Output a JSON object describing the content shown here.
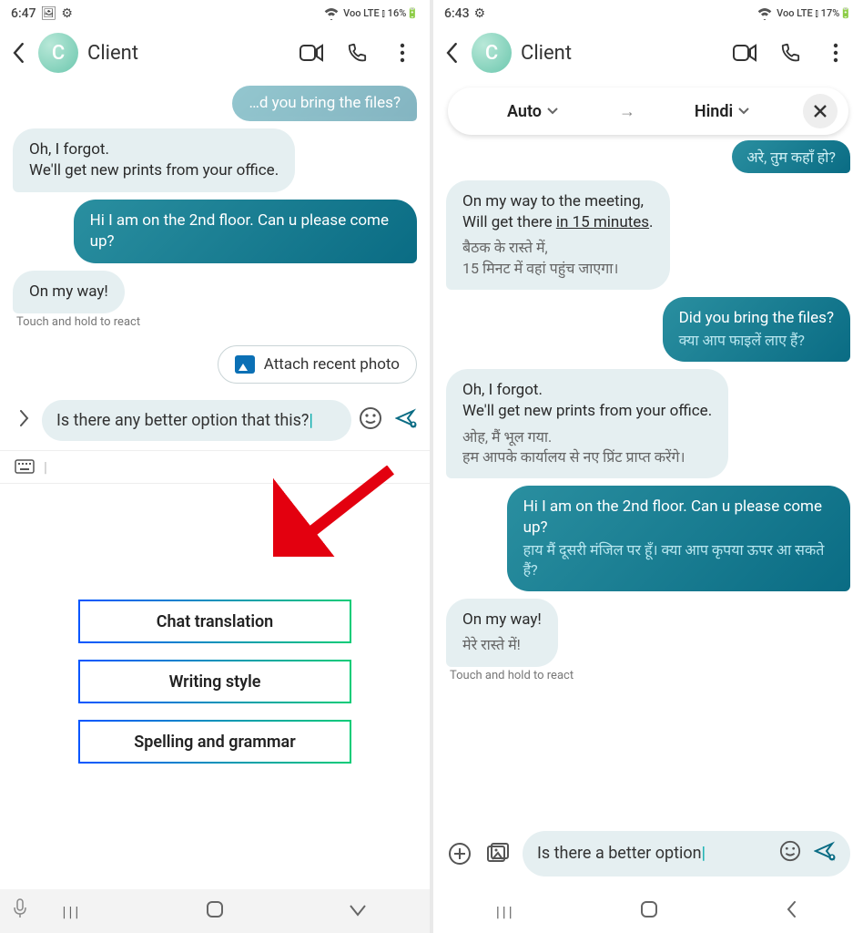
{
  "left": {
    "status": {
      "time": "6:47",
      "indicators": "Voo LTE ⫾ 16%🔋"
    },
    "contact": {
      "initial": "C",
      "name": "Client"
    },
    "messages": {
      "m0": "…d you bring the files?",
      "m1": "Oh, I forgot.\nWe'll get new prints from your office.",
      "m2": "Hi I am on the 2nd floor. Can u please come up?",
      "m3": "On my way!",
      "hint": "Touch and hold to react"
    },
    "attach": "Attach recent photo",
    "compose": "Is there any better option that this?",
    "options": {
      "o1": "Chat translation",
      "o2": "Writing style",
      "o3": "Spelling and grammar"
    }
  },
  "right": {
    "status": {
      "time": "6:43",
      "indicators": "Voo LTE ⫾ 17%🔋"
    },
    "contact": {
      "initial": "C",
      "name": "Client"
    },
    "translate": {
      "from": "Auto",
      "to": "Hindi"
    },
    "messages": {
      "m0": {
        "text": "अरे, तुम कहाँ हो?"
      },
      "m1": {
        "text": "On my way to the meeting,\nWill get there ",
        "link": "in 15 minutes",
        "tail": ".",
        "trans": "बैठक के रास्ते में,\n15 मिनट में वहां पहुंच जाएगा।"
      },
      "m2": {
        "text": "Did you bring the files?",
        "trans": "क्या आप फाइलें लाए हैं?"
      },
      "m3": {
        "text": "Oh, I forgot.\nWe'll get new prints from your office.",
        "trans": "ओह, मैं भूल गया.\nहम आपके कार्यालय से नए प्रिंट प्राप्त करेंगे।"
      },
      "m4": {
        "text": "Hi I am on the 2nd floor. Can u please come up?",
        "trans": "हाय मैं दूसरी मंजिल पर हूँ। क्या आप कृपया ऊपर आ सकते हैं?"
      },
      "m5": {
        "text": "On my way!",
        "trans": "मेरे रास्ते में!"
      },
      "hint": "Touch and hold to react"
    },
    "compose": "Is there a better option"
  }
}
